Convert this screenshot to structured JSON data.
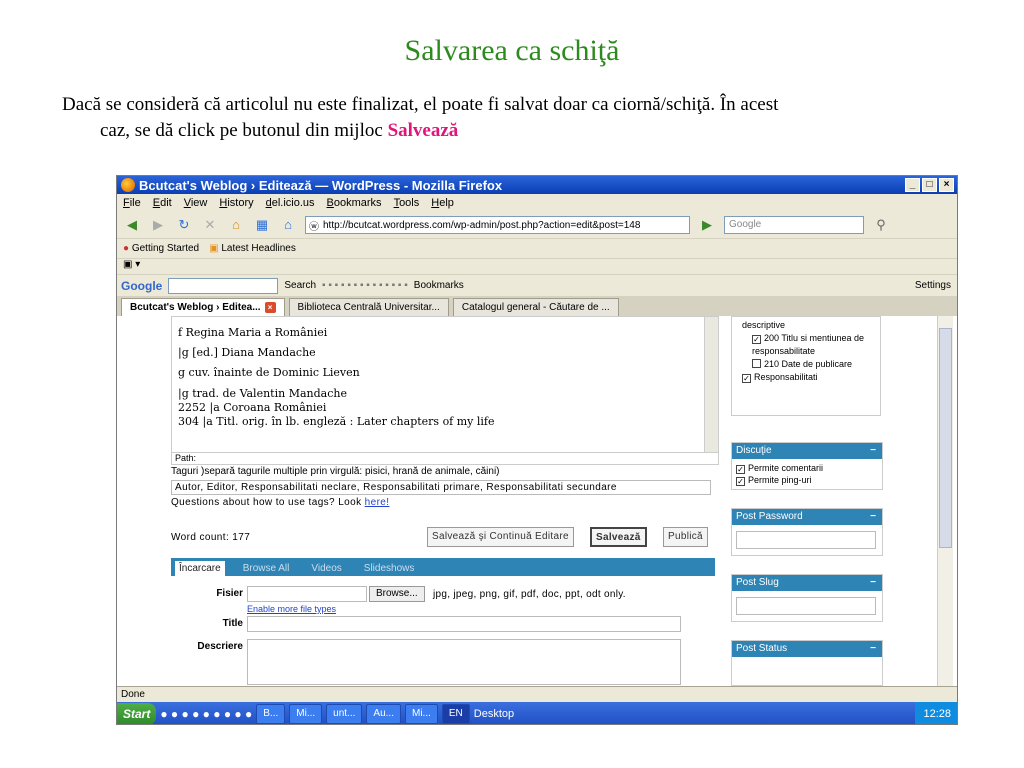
{
  "slide": {
    "title": "Salvarea ca schiţă",
    "body_line1": "Dacă se consideră că articolul nu este finalizat, el poate fi salvat doar ca ciornă/schiţă. În acest",
    "body_line2_prefix": "caz, se dă click pe butonul din mijloc ",
    "body_highlight": "Salvează"
  },
  "browser": {
    "window_title": "Bcutcat's Weblog › Editează — WordPress - Mozilla Firefox",
    "menu": [
      "File",
      "Edit",
      "View",
      "History",
      "del.icio.us",
      "Bookmarks",
      "Tools",
      "Help"
    ],
    "url": "http://bcutcat.wordpress.com/wp-admin/post.php?action=edit&post=148",
    "search_placeholder": "Google",
    "bookmarks": [
      "Getting Started",
      "Latest Headlines"
    ],
    "google_toolbar": {
      "logo": "Google",
      "search_label": "Search",
      "bookmarks_label": "Bookmarks",
      "settings_label": "Settings"
    },
    "tabs": [
      {
        "label": "Bcutcat's Weblog › Editea...",
        "active": true
      },
      {
        "label": "Biblioteca Centrală Universitar...",
        "active": false
      },
      {
        "label": "Catalogul general - Căutare de ...",
        "active": false
      }
    ],
    "status": "Done"
  },
  "editor": {
    "lines": [
      "f Regina Maria a României",
      "|g [ed.] Diana Mandache",
      "g cuv. înainte de Dominic Lieven",
      "|g trad. de Valentin Mandache",
      "2252 |a Coroana României",
      "304 |a Titl. orig. în lb. engleză : Later chapters of my life"
    ],
    "path_label": "Path:",
    "tags_hint": "Taguri )separă tagurile multiple prin virgulă: pisici, hrană de animale, căini)",
    "tags_value": "Autor, Editor, Responsabilitati neclare, Responsabilitati primare, Responsabilitati secundare",
    "help_text": "Questions about how to use tags? Look ",
    "help_link": "here!",
    "word_count": "Word count: 177",
    "btn_save_continue": "Salvează şi Continuă Editare",
    "btn_save": "Salvează",
    "btn_publish": "Publică"
  },
  "upload": {
    "tabs": [
      "Încarcare",
      "Browse All",
      "Videos",
      "Slideshows"
    ],
    "file_label": "Fisier",
    "browse_label": "Browse...",
    "file_types": "jpg, jpeg, png, gif, pdf, doc, ppt, odt only.",
    "enable_more": "Enable more file types",
    "title_label": "Title",
    "description_label": "Descriere"
  },
  "sidebar": {
    "categories": [
      "descriptive",
      "200 Titlu si mentiunea de responsabilitate",
      "210 Date de publicare",
      "Responsabilitati"
    ],
    "discussion_title": "Discuţie",
    "allow_comments": "Permite comentarii",
    "allow_pings": "Permite ping-uri",
    "password_title": "Post Password",
    "slug_title": "Post Slug",
    "status_title": "Post Status"
  },
  "taskbar": {
    "start": "Start",
    "items": [
      "B...",
      "Mi...",
      "unt...",
      "Au...",
      "Mi..."
    ],
    "lang": "EN",
    "desktop": "Desktop",
    "clock": "12:28"
  }
}
